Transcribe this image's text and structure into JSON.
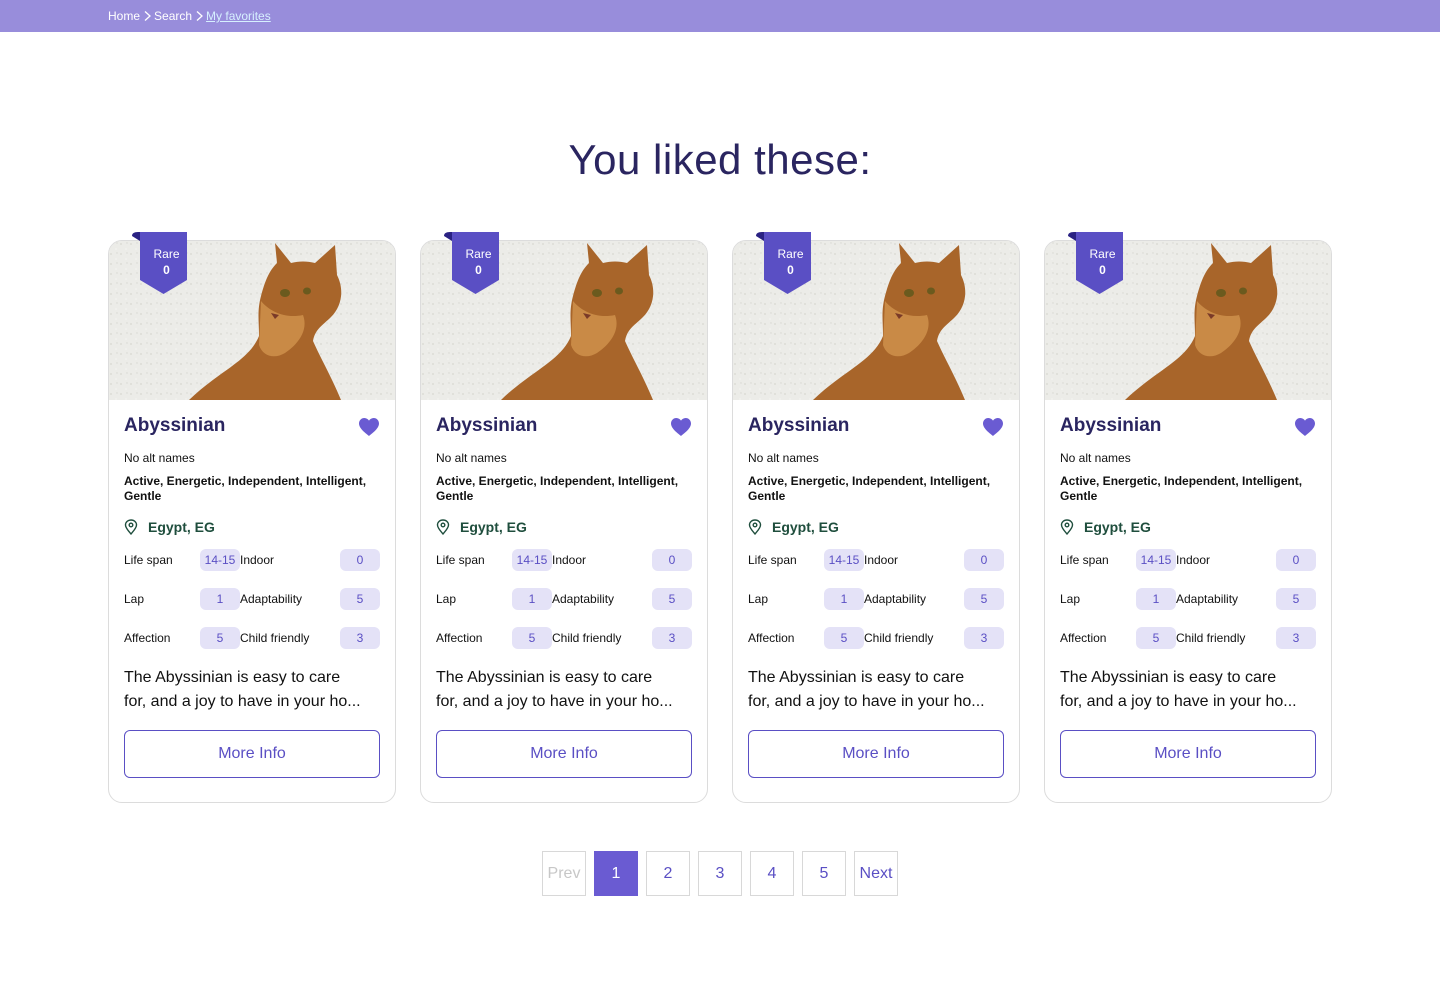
{
  "breadcrumb": {
    "items": [
      "Home",
      "Search",
      "My favorites"
    ]
  },
  "heading": "You liked these:",
  "colors": {
    "accent": "#6a5bd2",
    "topbar": "#988ddb",
    "title": "#2a2560",
    "location": "#1f4e3d"
  },
  "cards": [
    {
      "badge_label": "Rare",
      "badge_value": "0",
      "name": "Abyssinian",
      "alt_names": "No alt names",
      "temperament": "Active, Energetic, Independent, Intelligent, Gentle",
      "location": "Egypt, EG",
      "stats": {
        "life_span_label": "Life span",
        "life_span": "14-15",
        "indoor_label": "Indoor",
        "indoor": "0",
        "lap_label": "Lap",
        "lap": "1",
        "adaptability_label": "Adaptability",
        "adaptability": "5",
        "affection_label": "Affection",
        "affection": "5",
        "child_friendly_label": "Child friendly",
        "child_friendly": "3"
      },
      "description_line1": "The Abyssinian is easy to care",
      "description_line2": "for, and a joy to have in your ho...",
      "more_label": "More Info"
    },
    {
      "badge_label": "Rare",
      "badge_value": "0",
      "name": "Abyssinian",
      "alt_names": "No alt names",
      "temperament": "Active, Energetic, Independent, Intelligent, Gentle",
      "location": "Egypt, EG",
      "stats": {
        "life_span_label": "Life span",
        "life_span": "14-15",
        "indoor_label": "Indoor",
        "indoor": "0",
        "lap_label": "Lap",
        "lap": "1",
        "adaptability_label": "Adaptability",
        "adaptability": "5",
        "affection_label": "Affection",
        "affection": "5",
        "child_friendly_label": "Child friendly",
        "child_friendly": "3"
      },
      "description_line1": "The Abyssinian is easy to care",
      "description_line2": "for, and a joy to have in your ho...",
      "more_label": "More Info"
    },
    {
      "badge_label": "Rare",
      "badge_value": "0",
      "name": "Abyssinian",
      "alt_names": "No alt names",
      "temperament": "Active, Energetic, Independent, Intelligent, Gentle",
      "location": "Egypt, EG",
      "stats": {
        "life_span_label": "Life span",
        "life_span": "14-15",
        "indoor_label": "Indoor",
        "indoor": "0",
        "lap_label": "Lap",
        "lap": "1",
        "adaptability_label": "Adaptability",
        "adaptability": "5",
        "affection_label": "Affection",
        "affection": "5",
        "child_friendly_label": "Child friendly",
        "child_friendly": "3"
      },
      "description_line1": "The Abyssinian is easy to care",
      "description_line2": "for, and a joy to have in your ho...",
      "more_label": "More Info"
    },
    {
      "badge_label": "Rare",
      "badge_value": "0",
      "name": "Abyssinian",
      "alt_names": "No alt names",
      "temperament": "Active, Energetic, Independent, Intelligent, Gentle",
      "location": "Egypt, EG",
      "stats": {
        "life_span_label": "Life span",
        "life_span": "14-15",
        "indoor_label": "Indoor",
        "indoor": "0",
        "lap_label": "Lap",
        "lap": "1",
        "adaptability_label": "Adaptability",
        "adaptability": "5",
        "affection_label": "Affection",
        "affection": "5",
        "child_friendly_label": "Child friendly",
        "child_friendly": "3"
      },
      "description_line1": "The Abyssinian is easy to care",
      "description_line2": "for, and a joy to have in your ho...",
      "more_label": "More Info"
    }
  ],
  "pagination": {
    "prev_label": "Prev",
    "pages": [
      "1",
      "2",
      "3",
      "4",
      "5"
    ],
    "current": "1",
    "next_label": "Next"
  }
}
